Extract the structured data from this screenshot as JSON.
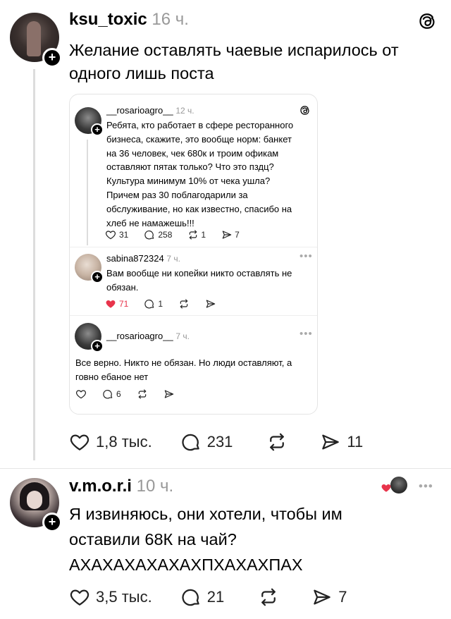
{
  "post1": {
    "username": "ksu_toxic",
    "time": "16 ч.",
    "text_line1": "Желание оставлять чаевые испарилось от",
    "text_line2": "одного лишь поста",
    "likes": "1,8 тыс.",
    "comments": "231",
    "reposts": "",
    "shares": "11"
  },
  "quote": {
    "op": {
      "username": "__rosarioagro__",
      "time": "12 ч.",
      "lines": [
        "Ребята, кто работает в сфере ресторанного",
        "бизнеса, скажите, это вообще норм: банкет",
        "на 36 человек, чек 680к и троим офикам",
        "оставляют пятак только? Что это пздц?",
        "Культура минимум 10% от чека ушла?",
        "Причем раз 30 поблагодарили за",
        "обслуживание, но как известно, спасибо на",
        "хлеб не намажешь!!!"
      ],
      "likes": "31",
      "comments": "258",
      "reposts": "1",
      "shares": "7"
    },
    "reply1": {
      "username": "sabina872324",
      "time": "7 ч.",
      "line1": "Вам вообще ни копейки никто оставлять не",
      "line2": "обязан.",
      "likes": "71",
      "comments": "1"
    },
    "reply2": {
      "username": "__rosarioagro__",
      "time": "7 ч.",
      "line1": "Все верно. Никто не обязан. Но люди оставляют, а",
      "line2": "говно ебаное нет",
      "comments": "6"
    }
  },
  "post2": {
    "username": "v.m.o.r.i",
    "time": "10 ч.",
    "line1": "Я извиняюсь, они хотели, чтобы им",
    "line2": "оставили 68К на чай?",
    "line3": "АХАХАХАХАХАХПХАХАХПАХ",
    "likes": "3,5 тыс.",
    "comments": "21",
    "shares": "7"
  },
  "icons": {
    "like": "heart-icon",
    "comment": "speech-bubble-icon",
    "repost": "repost-arrows-icon",
    "share": "paper-plane-icon",
    "threads": "threads-logo-icon",
    "more": "ellipsis-icon"
  },
  "colors": {
    "liked": "#e8344b",
    "muted": "#999999",
    "text": "#000000"
  }
}
